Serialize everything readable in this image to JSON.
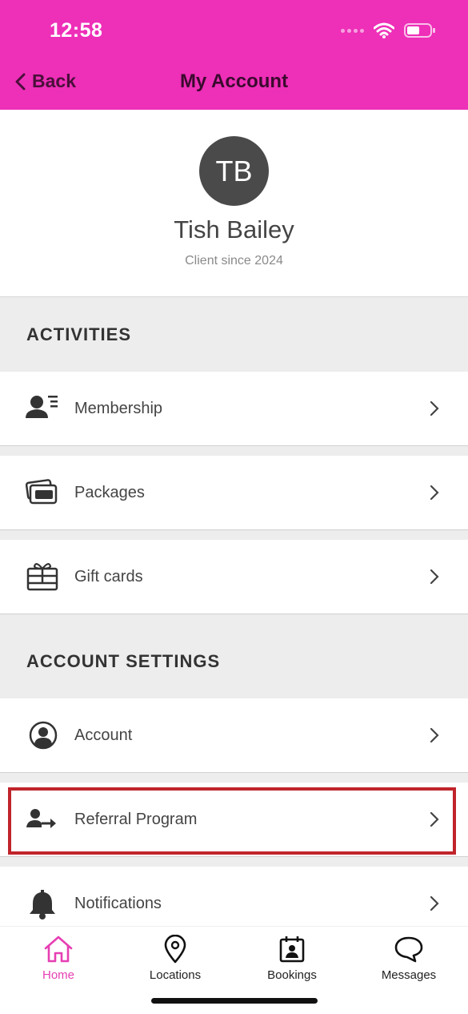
{
  "status": {
    "time": "12:58"
  },
  "header": {
    "back_label": "Back",
    "title": "My Account"
  },
  "profile": {
    "initials": "TB",
    "name": "Tish Bailey",
    "client_since": "Client since 2024"
  },
  "activities": {
    "heading": "ACTIVITIES",
    "items": [
      {
        "label": "Membership",
        "icon": "membership-icon"
      },
      {
        "label": "Packages",
        "icon": "packages-icon"
      },
      {
        "label": "Gift cards",
        "icon": "gift-card-icon"
      }
    ]
  },
  "account_settings": {
    "heading": "ACCOUNT SETTINGS",
    "items": [
      {
        "label": "Account",
        "icon": "user-circle-icon"
      },
      {
        "label": "Referral Program",
        "icon": "referral-icon"
      },
      {
        "label": "Notifications",
        "icon": "bell-icon"
      }
    ]
  },
  "tabbar": {
    "items": [
      {
        "label": "Home",
        "icon": "home-icon",
        "active": true
      },
      {
        "label": "Locations",
        "icon": "location-pin-icon"
      },
      {
        "label": "Bookings",
        "icon": "calendar-icon"
      },
      {
        "label": "Messages",
        "icon": "chat-bubble-icon"
      }
    ]
  },
  "colors": {
    "brand": "#ee2fb8",
    "active_tab": "#e63fb3",
    "highlight": "#c0242b",
    "section_bg": "#ededed"
  }
}
